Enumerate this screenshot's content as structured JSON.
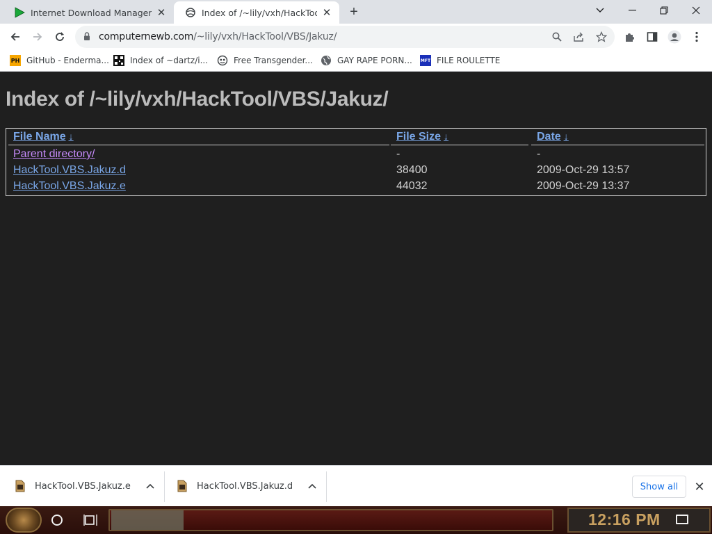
{
  "tabs": [
    {
      "title": "Internet Download Manager: Th",
      "icon": "idm-play-icon",
      "active": false
    },
    {
      "title": "Index of /~lily/vxh/HackTool/",
      "icon": "page-globe-icon",
      "active": true
    }
  ],
  "toolbar": {
    "url_host": "computernewb.com",
    "url_path": "/~lily/vxh/HackTool/VBS/Jakuz/"
  },
  "bookmarks": [
    {
      "label": "GitHub - Enderma...",
      "icon": "ph-icon",
      "icon_text": "PH"
    },
    {
      "label": "Index of ~dartz/i...",
      "icon": "qr-icon"
    },
    {
      "label": "Free Transgender...",
      "icon": "mask-icon"
    },
    {
      "label": "GAY RAPE PORN...",
      "icon": "globe-icon"
    },
    {
      "label": "FILE ROULETTE",
      "icon": "mft-icon",
      "icon_text": "MFT"
    }
  ],
  "page": {
    "heading": "Index of /~lily/vxh/HackTool/VBS/Jakuz/",
    "columns": {
      "name": "File Name",
      "size": "File Size",
      "date": "Date",
      "sort_arrow": "↓"
    },
    "rows": [
      {
        "name": "Parent directory/",
        "size": "-",
        "date": "-",
        "visited": true
      },
      {
        "name": "HackTool.VBS.Jakuz.d",
        "size": "38400",
        "date": "2009-Oct-29 13:57",
        "visited": false
      },
      {
        "name": "HackTool.VBS.Jakuz.e",
        "size": "44032",
        "date": "2009-Oct-29 13:37",
        "visited": false
      }
    ]
  },
  "downloads": {
    "items": [
      {
        "filename": "HackTool.VBS.Jakuz.e"
      },
      {
        "filename": "HackTool.VBS.Jakuz.d"
      }
    ],
    "show_all": "Show all"
  },
  "taskbar": {
    "clock": "12:16 PM"
  },
  "colors": {
    "link": "#7aa7e8",
    "visited": "#c58af9",
    "page_bg": "#1f1f1f",
    "heading": "#bcbcbc"
  }
}
